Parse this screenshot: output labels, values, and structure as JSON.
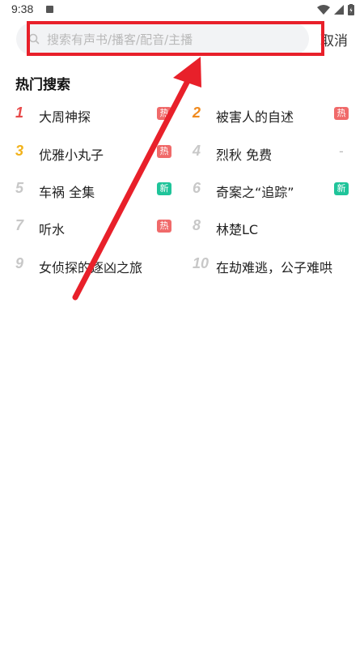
{
  "status_bar": {
    "time": "9:38"
  },
  "search": {
    "placeholder": "搜索有声书/播客/配音/主播",
    "cancel_label": "取消"
  },
  "hot": {
    "title": "热门搜索",
    "items": [
      {
        "rank": "1",
        "label": "大周神探",
        "badge": "热",
        "rank_color": "#e84a4a",
        "badge_color": "#f06a6a"
      },
      {
        "rank": "2",
        "label": "被害人的自述",
        "badge": "热",
        "rank_color": "#f08a1e",
        "badge_color": "#f06a6a"
      },
      {
        "rank": "3",
        "label": "优雅小丸子",
        "badge": "热",
        "rank_color": "#f2b21a",
        "badge_color": "#f06a6a"
      },
      {
        "rank": "4",
        "label": "烈秋 免费",
        "badge": "-",
        "rank_color": "#c8c8c8",
        "badge_color": ""
      },
      {
        "rank": "5",
        "label": "车祸 全集",
        "badge": "新",
        "rank_color": "#c8c8c8",
        "badge_color": "#1fc49a"
      },
      {
        "rank": "6",
        "label": "奇案之“追踪”",
        "badge": "新",
        "rank_color": "#c8c8c8",
        "badge_color": "#1fc49a"
      },
      {
        "rank": "7",
        "label": "听水",
        "badge": "热",
        "rank_color": "#c8c8c8",
        "badge_color": "#f06a6a"
      },
      {
        "rank": "8",
        "label": "林楚LC",
        "badge": "",
        "rank_color": "#c8c8c8",
        "badge_color": ""
      },
      {
        "rank": "9",
        "label": "女侦探的逐凶之旅",
        "badge": "",
        "rank_color": "#c8c8c8",
        "badge_color": ""
      },
      {
        "rank": "10",
        "label": "在劫难逃，公子难哄",
        "badge": "",
        "rank_color": "#c8c8c8",
        "badge_color": ""
      }
    ]
  },
  "annotation": {
    "color": "#e8202a"
  }
}
